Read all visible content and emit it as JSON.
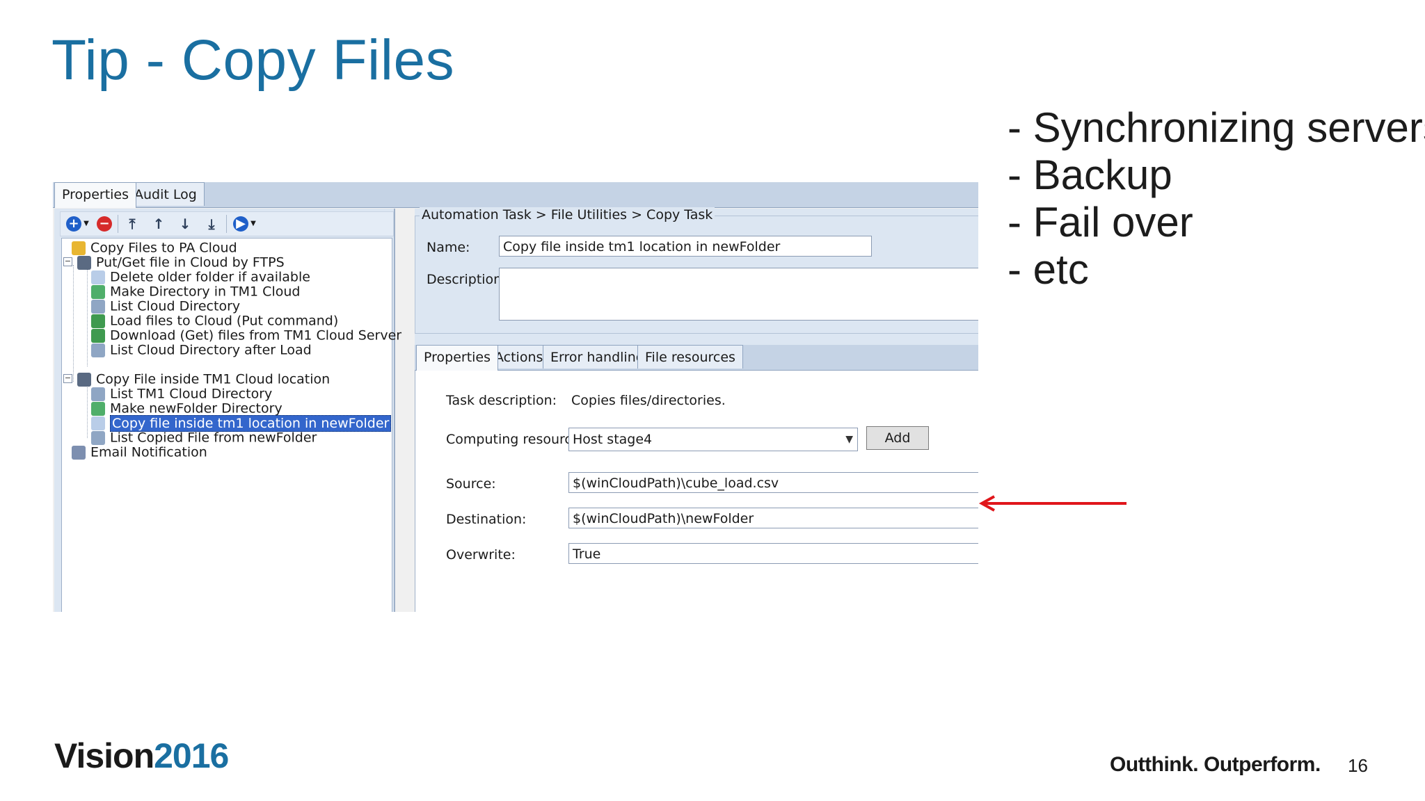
{
  "slide": {
    "title": "Tip - Copy Files",
    "bullets": [
      "- Synchronizing servers",
      "- Backup",
      "- Fail over",
      "- etc"
    ],
    "logo_part1": "Vision",
    "logo_part2": "2016",
    "tagline": "Outthink. Outperform.",
    "page_number": "16",
    "colors": {
      "title": "#1a6fa1",
      "arrow": "#e0161b",
      "logo_accent": "#1a6fa1"
    }
  },
  "window": {
    "tabs": [
      "Properties",
      "Audit Log"
    ],
    "toolbar_icons": [
      "add-icon",
      "remove-icon",
      "move-top-icon",
      "move-up-icon",
      "move-down-icon",
      "move-bottom-icon",
      "run-icon"
    ],
    "tree": [
      {
        "label": "Copy Files to PA Cloud",
        "icon": "chain-icon"
      },
      {
        "label": "Put/Get file in Cloud by FTPS",
        "icon": "tasklist-icon"
      },
      {
        "label": "Delete older folder if available",
        "icon": "delete-file-icon"
      },
      {
        "label": "Make Directory in TM1 Cloud",
        "icon": "make-dir-icon"
      },
      {
        "label": "List Cloud Directory",
        "icon": "list-dir-icon"
      },
      {
        "label": "Load files to Cloud (Put command)",
        "icon": "upload-icon"
      },
      {
        "label": "Download (Get) files from TM1 Cloud Server",
        "icon": "download-icon"
      },
      {
        "label": "List Cloud Directory after Load",
        "icon": "list-dir-icon"
      },
      {
        "label": "Copy File inside TM1 Cloud location",
        "icon": "tasklist-icon"
      },
      {
        "label": "List TM1 Cloud Directory",
        "icon": "list-dir-icon"
      },
      {
        "label": "Make newFolder Directory",
        "icon": "make-dir-icon"
      },
      {
        "label": "Copy file inside tm1 location in newFolder",
        "icon": "copy-file-icon"
      },
      {
        "label": "List Copied File from newFolder",
        "icon": "list-dir-icon"
      },
      {
        "label": "Email Notification",
        "icon": "email-icon"
      }
    ],
    "breadcrumb": "Automation Task > File Utilities > Copy Task",
    "name_label": "Name:",
    "name_value": "Copy file inside tm1 location in newFolder",
    "description_label": "Description:",
    "description_value": "",
    "subtabs": [
      "Properties",
      "Actions",
      "Error handling",
      "File resources"
    ],
    "task_description_label": "Task description:",
    "task_description_value": "Copies files/directories.",
    "computing_resource_label": "Computing resource:",
    "computing_resource_value": "Host stage4",
    "add_button": "Add",
    "source_label": "Source:",
    "source_value": "$(winCloudPath)\\cube_load.csv",
    "destination_label": "Destination:",
    "destination_value": "$(winCloudPath)\\newFolder",
    "overwrite_label": "Overwrite:",
    "overwrite_value": "True"
  }
}
